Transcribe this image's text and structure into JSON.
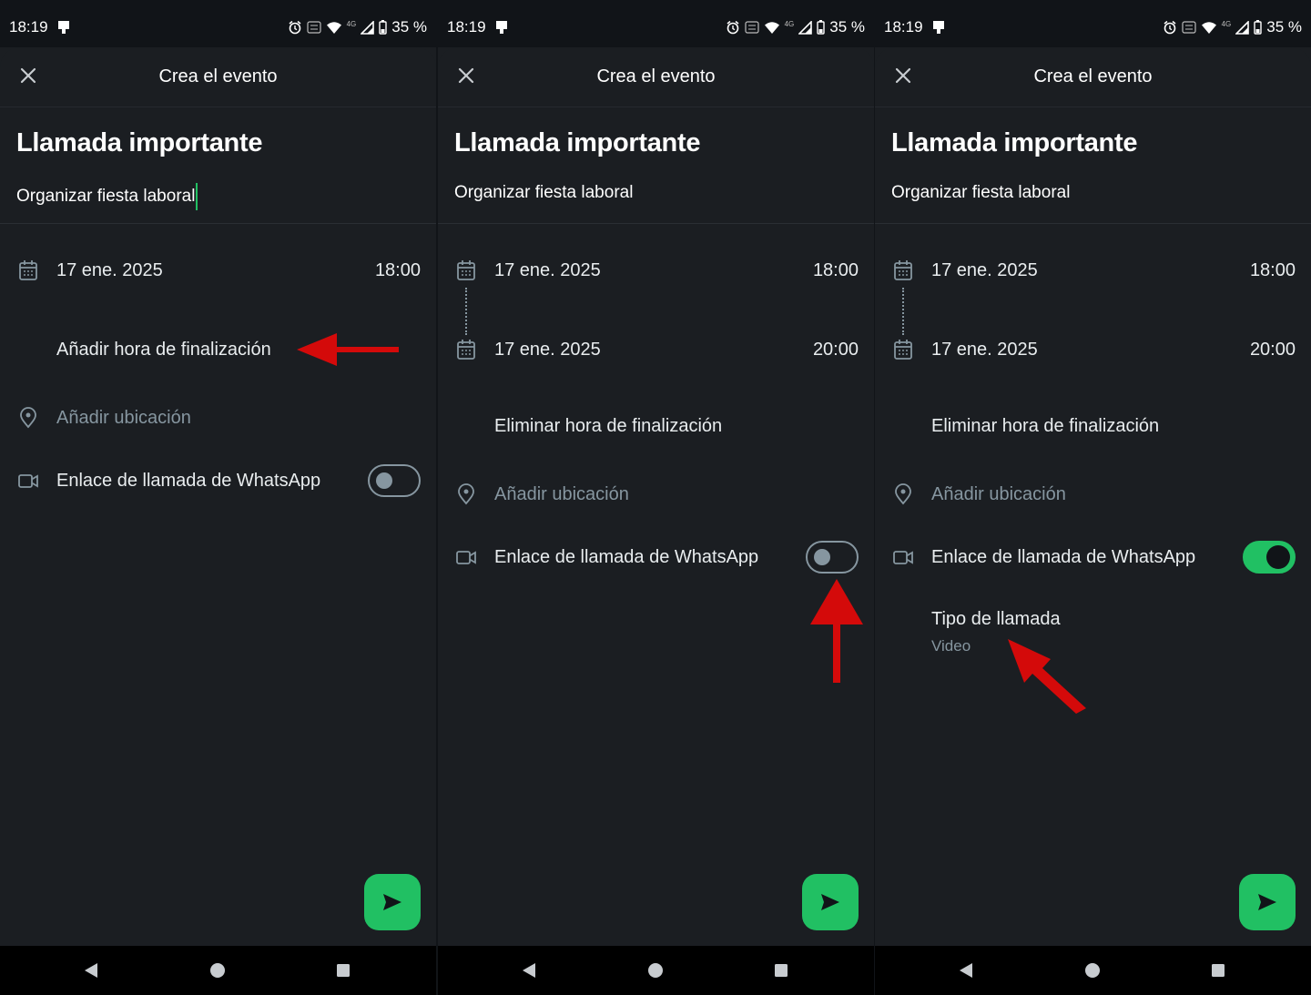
{
  "status_bar": {
    "time": "18:19",
    "battery": "35 %",
    "network": "4G"
  },
  "app_bar": {
    "title": "Crea el evento"
  },
  "event": {
    "name": "Llamada importante",
    "description": "Organizar fiesta laboral"
  },
  "start": {
    "date": "17 ene. 2025",
    "time": "18:00"
  },
  "end": {
    "date": "17 ene. 2025",
    "time": "20:00"
  },
  "labels": {
    "add_end_time": "Añadir hora de finalización",
    "remove_end_time": "Eliminar hora de finalización",
    "add_location": "Añadir ubicación",
    "whatsapp_call_link": "Enlace de llamada de WhatsApp",
    "call_type": "Tipo de llamada",
    "call_type_value": "Video"
  },
  "toggle_states": {
    "panel_1": false,
    "panel_2": false,
    "panel_3": true
  },
  "colors": {
    "accent": "#21c063",
    "annotation_arrow": "#d40a0a",
    "background": "#1b1e22",
    "muted_text": "#8696a0"
  },
  "icons": [
    "close-icon",
    "calendar-icon",
    "location-pin-icon",
    "video-camera-icon",
    "send-icon",
    "back-icon",
    "home-icon",
    "recents-icon",
    "alarm-icon",
    "wifi-icon",
    "signal-icon",
    "battery-icon"
  ]
}
